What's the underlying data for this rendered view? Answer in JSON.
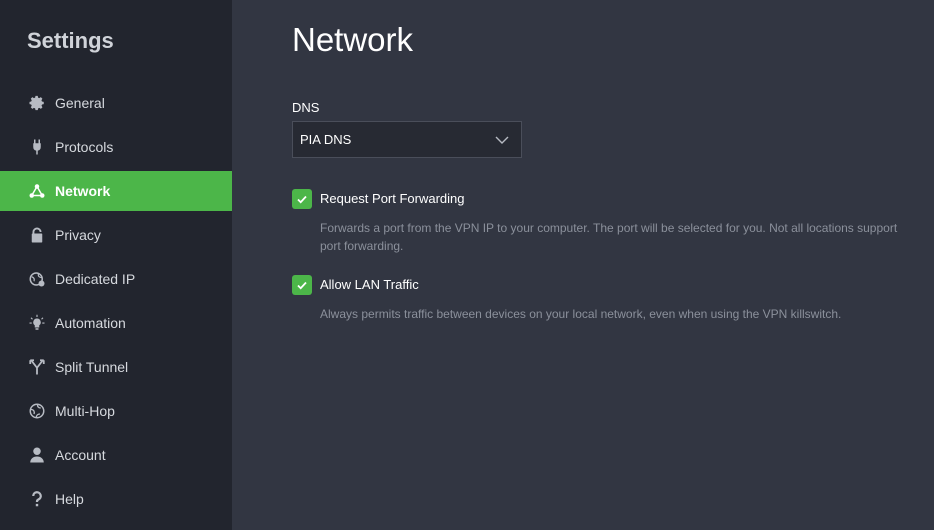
{
  "sidebar": {
    "title": "Settings",
    "items": [
      {
        "label": "General",
        "icon": "gear-icon"
      },
      {
        "label": "Protocols",
        "icon": "plug-icon"
      },
      {
        "label": "Network",
        "icon": "network-icon",
        "active": true
      },
      {
        "label": "Privacy",
        "icon": "lock-icon"
      },
      {
        "label": "Dedicated IP",
        "icon": "globe-badge-icon"
      },
      {
        "label": "Automation",
        "icon": "lightbulb-icon"
      },
      {
        "label": "Split Tunnel",
        "icon": "split-icon"
      },
      {
        "label": "Multi-Hop",
        "icon": "globe-icon"
      },
      {
        "label": "Account",
        "icon": "person-icon"
      },
      {
        "label": "Help",
        "icon": "question-icon"
      }
    ]
  },
  "main": {
    "title": "Network",
    "dns": {
      "label": "DNS",
      "value": "PIA DNS"
    },
    "options": [
      {
        "label": "Request Port Forwarding",
        "checked": true,
        "description": "Forwards a port from the VPN IP to your computer. The port will be selected for you. Not all locations support port forwarding."
      },
      {
        "label": "Allow LAN Traffic",
        "checked": true,
        "description": "Always permits traffic between devices on your local network, even when using the VPN killswitch."
      }
    ]
  },
  "colors": {
    "accent": "#4cb649",
    "sidebar_bg": "#22252e",
    "main_bg": "#323642"
  }
}
